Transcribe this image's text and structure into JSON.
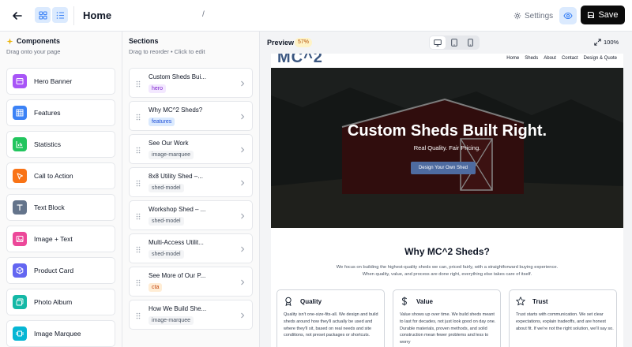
{
  "header": {
    "title": "Home",
    "path": "/",
    "settings_label": "Settings",
    "save_label": "Save"
  },
  "components_panel": {
    "title": "Components",
    "subtitle": "Drag onto your page",
    "items": [
      {
        "label": "Hero Banner",
        "icon": "hero-banner-icon",
        "color": "#a855f7"
      },
      {
        "label": "Features",
        "icon": "features-grid-icon",
        "color": "#3b82f6"
      },
      {
        "label": "Statistics",
        "icon": "statistics-chart-icon",
        "color": "#22c55e"
      },
      {
        "label": "Call to Action",
        "icon": "pointer-icon",
        "color": "#f97316"
      },
      {
        "label": "Text Block",
        "icon": "text-icon",
        "color": "#64748b"
      },
      {
        "label": "Image + Text",
        "icon": "image-icon",
        "color": "#ec4899"
      },
      {
        "label": "Product Card",
        "icon": "package-icon",
        "color": "#6366f1"
      },
      {
        "label": "Photo Album",
        "icon": "photo-album-icon",
        "color": "#14b8a6"
      },
      {
        "label": "Image Marquee",
        "icon": "marquee-icon",
        "color": "#06b6d4"
      }
    ]
  },
  "sections_panel": {
    "title": "Sections",
    "subtitle": "Drag to reorder • Click to edit",
    "items": [
      {
        "name": "Custom Sheds Bui...",
        "tag": "hero",
        "tag_bg": "#f3e8ff",
        "tag_color": "#7e22ce"
      },
      {
        "name": "Why MC^2 Sheds?",
        "tag": "features",
        "tag_bg": "#dbeafe",
        "tag_color": "#1d4ed8"
      },
      {
        "name": "See Our Work",
        "tag": "image-marquee",
        "tag_bg": "#f3f4f6",
        "tag_color": "#4b5563"
      },
      {
        "name": "8x8 Utility Shed –...",
        "tag": "shed-model",
        "tag_bg": "#f3f4f6",
        "tag_color": "#4b5563"
      },
      {
        "name": "Workshop Shed – ...",
        "tag": "shed-model",
        "tag_bg": "#f3f4f6",
        "tag_color": "#4b5563"
      },
      {
        "name": "Multi-Access Utilit...",
        "tag": "shed-model",
        "tag_bg": "#f3f4f6",
        "tag_color": "#4b5563"
      },
      {
        "name": "See More of Our P...",
        "tag": "cta",
        "tag_bg": "#ffedd5",
        "tag_color": "#c2410c"
      },
      {
        "name": "How We Build She...",
        "tag": "image-marquee",
        "tag_bg": "#f3f4f6",
        "tag_color": "#4b5563"
      }
    ]
  },
  "preview": {
    "label": "Preview",
    "badge": "57%",
    "zoom_label": "100%"
  },
  "site": {
    "logo_text": "MC^2",
    "nav_links": [
      "Home",
      "Sheds",
      "About",
      "Contact",
      "Design & Quote"
    ],
    "hero_title": "Custom Sheds Built Right.",
    "hero_subtitle": "Real Quality. Fair Pricing.",
    "hero_cta": "Design Your Own Shed",
    "why_title": "Why MC^2 Sheds?",
    "why_desc_1": "We focus on building the highest-quality sheds we can, priced fairly, with a straightforward buying experience.",
    "why_desc_2": "When quality, value, and process are done right, everything else takes care of itself.",
    "features": [
      {
        "title": "Quality",
        "icon": "award-icon",
        "body": "Quality isn't one-size-fits-all. We design and build sheds around how they'll actually be used and where they'll sit, based on real needs and site conditions, not preset packages or shortcuts."
      },
      {
        "title": "Value",
        "icon": "dollar-icon",
        "body": "Value shows up over time. We build sheds meant to last for decades, not just look good on day one. Durable materials, proven methods, and solid construction mean fewer problems and less to worry"
      },
      {
        "title": "Trust",
        "icon": "star-icon",
        "body": "Trust starts with communication. We set clear expectations, explain tradeoffs, and are honest about fit. If we're not the right solution, we'll say so."
      }
    ]
  },
  "colors": {
    "accent": "#3b82f6",
    "save_bg": "#0b0b0b",
    "hero_button": "#4e6ba0",
    "logo": "#3a5680"
  }
}
